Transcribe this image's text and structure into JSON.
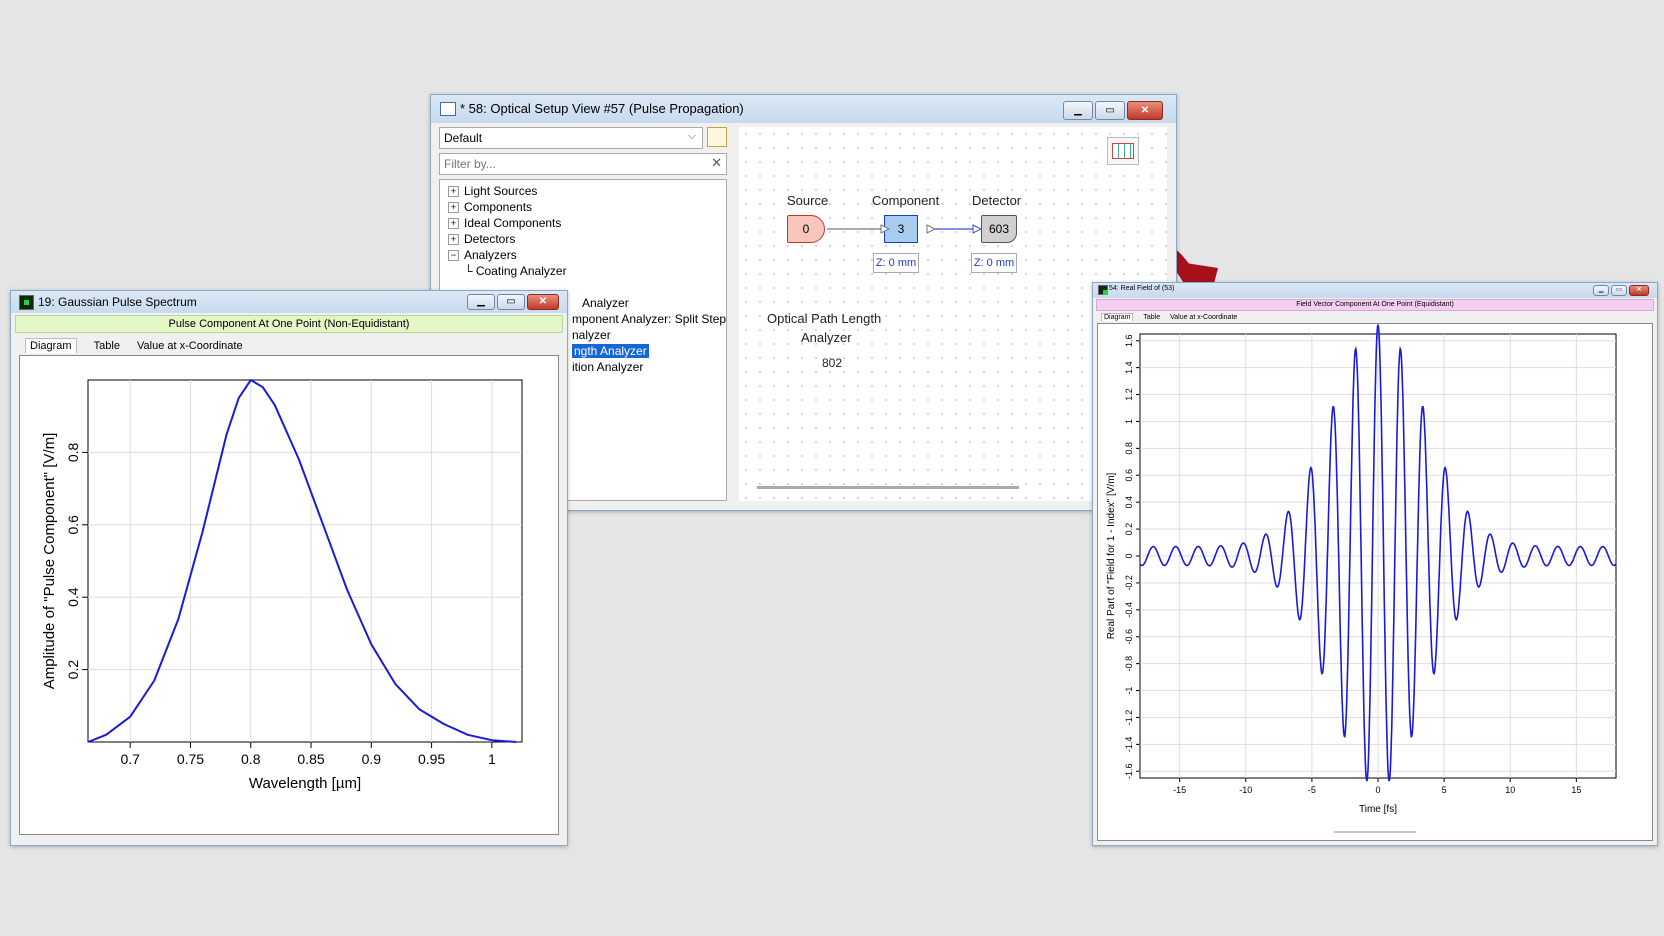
{
  "setup_window": {
    "title": "* 58: Optical Setup View #57 (Pulse Propagation)",
    "preset": "Default",
    "filter_placeholder": "Filter by...",
    "tree": [
      {
        "label": "Light Sources",
        "expander": "+"
      },
      {
        "label": "Components",
        "expander": "+"
      },
      {
        "label": "Ideal Components",
        "expander": "+"
      },
      {
        "label": "Detectors",
        "expander": "+"
      },
      {
        "label": "Analyzers",
        "expander": "−"
      },
      {
        "label": "Coating Analyzer"
      }
    ],
    "tree_partial": [
      {
        "label": "Analyzer"
      },
      {
        "label": "mponent Analyzer: Split Step"
      },
      {
        "label": "nalyzer"
      },
      {
        "label": "ngth Analyzer",
        "selected": true
      },
      {
        "label": "ition Analyzer"
      }
    ],
    "nodes": {
      "source": {
        "label": "Source",
        "id": "0",
        "color": "#f6c5bc"
      },
      "component": {
        "label": "Component",
        "id": "3",
        "color": "#a9cbf0",
        "z": "Z: 0 mm"
      },
      "detector": {
        "label": "Detector",
        "id": "603",
        "color": "#d0d0d0",
        "z": "Z: 0 mm"
      },
      "analyzer": {
        "label_line1": "Optical Path Length",
        "label_line2": "Analyzer",
        "id": "802"
      }
    }
  },
  "spectrum_window": {
    "title": "19: Gaussian Pulse Spectrum",
    "subheader": "Pulse Component At One Point (Non-Equidistant)",
    "subheader_color": "#e3f6c6",
    "tabs": [
      "Diagram",
      "Table",
      "Value at x-Coordinate"
    ]
  },
  "field_window": {
    "title": "54: Real Field of (53)",
    "subheader": "Field Vector Component At One Point (Equidistant)",
    "subheader_color": "#f4cff2",
    "tabs": [
      "Diagram",
      "Table",
      "Value at x-Coordinate"
    ]
  },
  "arrow_color": "#a8101c",
  "chart_data": [
    {
      "type": "line",
      "xlabel": "Wavelength [µm]",
      "ylabel": "Amplitude of \"Pulse Component\" [V/m]",
      "xlim": [
        0.665,
        1.025
      ],
      "ylim": [
        0,
        1.0
      ],
      "x_ticks": [
        "0.7",
        "0.75",
        "0.8",
        "0.85",
        "0.9",
        "0.95",
        "1"
      ],
      "x_tick_values": [
        0.7,
        0.75,
        0.8,
        0.85,
        0.9,
        0.95,
        1.0
      ],
      "y_ticks": [
        "0.2",
        "0.4",
        "0.6",
        "0.8"
      ],
      "y_tick_values": [
        0.2,
        0.4,
        0.6,
        0.8
      ],
      "grid": true,
      "series": [
        {
          "color": "#1a1adb",
          "x": [
            0.665,
            0.68,
            0.7,
            0.72,
            0.74,
            0.76,
            0.78,
            0.79,
            0.8,
            0.81,
            0.82,
            0.84,
            0.86,
            0.88,
            0.9,
            0.92,
            0.94,
            0.96,
            0.98,
            1.0,
            1.02
          ],
          "y": [
            0.0,
            0.02,
            0.07,
            0.17,
            0.34,
            0.58,
            0.85,
            0.95,
            1.0,
            0.98,
            0.93,
            0.78,
            0.6,
            0.42,
            0.27,
            0.16,
            0.09,
            0.05,
            0.02,
            0.005,
            0.0
          ]
        }
      ]
    },
    {
      "type": "line",
      "xlabel": "Time [fs]",
      "ylabel": "Real Part of \"Field for 1 - Index\" [V/m]",
      "xlim": [
        -18,
        18
      ],
      "ylim": [
        -1.65,
        1.65
      ],
      "x_ticks": [
        "-15",
        "-10",
        "-5",
        "0",
        "5",
        "10",
        "15"
      ],
      "x_tick_values": [
        -15,
        -10,
        -5,
        0,
        5,
        10,
        15
      ],
      "y_ticks": [
        "1.6",
        "1.4",
        "1.2",
        "1",
        "0.8",
        "0.6",
        "0.4",
        "0.2",
        "0",
        "-0.2",
        "-0.4",
        "-0.6",
        "-0.8",
        "-1",
        "-1.2",
        "-1.4",
        "-1.6"
      ],
      "y_tick_values": [
        1.6,
        1.4,
        1.2,
        1.0,
        0.8,
        0.6,
        0.4,
        0.2,
        0,
        -0.2,
        -0.4,
        -0.6,
        -0.8,
        -1.0,
        -1.2,
        -1.4,
        -1.6
      ],
      "grid": true,
      "series": [
        {
          "color": "#1a1adb",
          "envelope": "gaussian",
          "peak_amplitude": 1.65,
          "envelope_width_fs": 5,
          "baseline_ripple": 0.07,
          "period_fs": 1.7
        }
      ]
    }
  ]
}
